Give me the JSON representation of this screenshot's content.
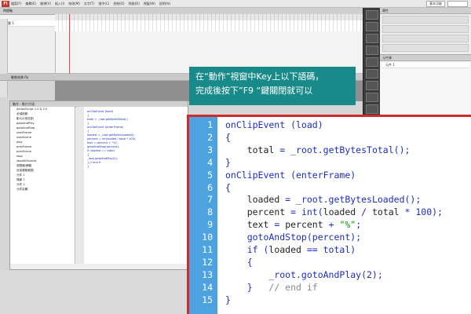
{
  "menubar": {
    "logo": "Fl",
    "items": [
      "檔案(F)",
      "編輯(E)",
      "檢視(V)",
      "插入(I)",
      "修改(M)",
      "文字(T)",
      "指令(C)",
      "控制(O)",
      "除錯(D)",
      "視窗(W)",
      "說明(H)"
    ],
    "workspace": "基本功能"
  },
  "timeline": {
    "tab": "時間軸",
    "layers": [
      "圖層 1"
    ]
  },
  "stage": {
    "tab": "動態效果.fla"
  },
  "properties": {
    "title": "屬性"
  },
  "library": {
    "title": "元件庫",
    "items": [
      "元件 1"
    ]
  },
  "actions": {
    "tabs": "動作 - 影片片段",
    "tree": [
      "ActionScript 1.0 & 2.0",
      "全域函數",
      "影片片段控制",
      "gotoAndPlay",
      "gotoAndStop",
      "nextFrame",
      "nextScene",
      "play",
      "prevFrame",
      "prevScene",
      "stop",
      "stopAllSounds",
      "瀏覽器/網路",
      "目前選取範圍",
      "元件 1",
      "場景 1",
      "元件 1",
      "元件定義"
    ],
    "mini_code": [
      "onClipEvent (load)",
      "{",
      "    total = _root.getBytesTotal();",
      "}",
      "onClipEvent (enterFrame)",
      "{",
      "    loaded = _root.getBytesLoaded();",
      "    percent = int(loaded / total * 100);",
      "    text = percent + \"%\";",
      "    gotoAndStop(percent);",
      "    if (loaded == total)",
      "    {",
      "        _root.gotoAndPlay(2);",
      "    }   // end if",
      "}"
    ]
  },
  "callout": {
    "line1": "在“動作”視窗中Key上以下語碼，",
    "line2": "完成後按下”F9 “鍵關閉就可以"
  },
  "code": {
    "lines": [
      {
        "num": "1",
        "text": "onClipEvent (load)"
      },
      {
        "num": "2",
        "text": "{"
      },
      {
        "num": "3",
        "text": "    total = _root.getBytesTotal();"
      },
      {
        "num": "4",
        "text": "}"
      },
      {
        "num": "5",
        "text": "onClipEvent (enterFrame)"
      },
      {
        "num": "6",
        "text": "{"
      },
      {
        "num": "7",
        "text": "    loaded = _root.getBytesLoaded();"
      },
      {
        "num": "8",
        "text": "    percent = int(loaded / total * 100);"
      },
      {
        "num": "9",
        "text": "    text = percent + \"%\";"
      },
      {
        "num": "10",
        "text": "    gotoAndStop(percent);"
      },
      {
        "num": "11",
        "text": "    if (loaded == total)"
      },
      {
        "num": "12",
        "text": "    {"
      },
      {
        "num": "13",
        "text": "        _root.gotoAndPlay(2);"
      },
      {
        "num": "14",
        "text": "    }   // end if"
      },
      {
        "num": "15",
        "text": "}"
      }
    ]
  }
}
